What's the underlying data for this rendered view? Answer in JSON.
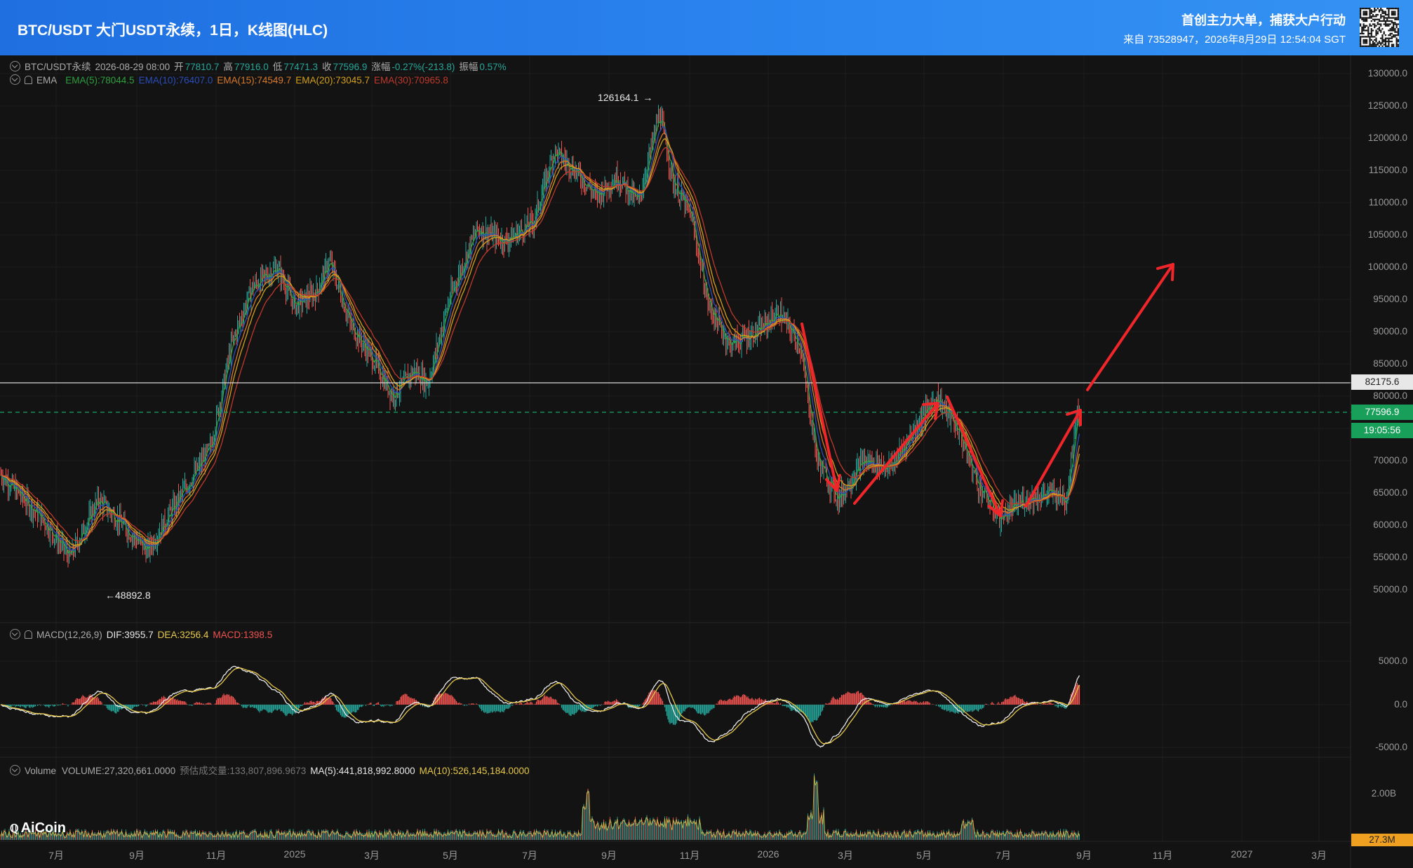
{
  "header": {
    "title": "BTC/USDT 大门USDT永续，1日，K线图(HLC)",
    "slogan": "首创主力大单，捕获大户行动",
    "source": "来自 73528947，2026年8月29日 12:54:04 SGT"
  },
  "legend_main": {
    "symbol": "BTC/USDT永续",
    "date": "2026-08-29 08:00",
    "open_label": "开",
    "open": "77810.7",
    "high_label": "高",
    "high": "77916.0",
    "low_label": "低",
    "low": "77471.3",
    "close_label": "收",
    "close": "77596.9",
    "change_label": "涨幅",
    "change": "-0.27%(-213.8)",
    "amp_label": "振幅",
    "amp": "0.57%"
  },
  "legend_ema": {
    "name": "EMA",
    "ema5": "EMA(5):78044.5",
    "ema10": "EMA(10):76407.0",
    "ema15": "EMA(15):74549.7",
    "ema20": "EMA(20):73045.7",
    "ema30": "EMA(30):70965.8"
  },
  "legend_macd": {
    "name": "MACD(12,26,9)",
    "dif": "DIF:3955.7",
    "dea": "DEA:3256.4",
    "macd": "MACD:1398.5"
  },
  "legend_volume": {
    "name": "Volume",
    "volume": "VOLUME:27,320,661.0000",
    "est": "预估成交量:133,807,896.9673",
    "ma5": "MA(5):441,818,992.8000",
    "ma10": "MA(10):526,145,184.0000"
  },
  "price_axis": [
    "130000.0",
    "125000.0",
    "120000.0",
    "115000.0",
    "110000.0",
    "105000.0",
    "100000.0",
    "95000.0",
    "90000.0",
    "85000.0",
    "80000.0",
    "70000.0",
    "65000.0",
    "60000.0",
    "55000.0",
    "50000.0"
  ],
  "macd_axis": [
    "5000.0",
    "0.0",
    "-5000.0"
  ],
  "volume_axis": [
    "2.00B"
  ],
  "price_tags": {
    "line_price": "82175.6",
    "last_price": "77596.9",
    "countdown": "19:05:56",
    "volume_tag": "27.3M"
  },
  "annotations": {
    "high": "126164.1",
    "low": "48892.8"
  },
  "x_axis": [
    "7月",
    "9月",
    "11月",
    "2025",
    "3月",
    "5月",
    "7月",
    "9月",
    "11月",
    "2026",
    "3月",
    "5月",
    "7月",
    "9月",
    "11月",
    "2027",
    "3月"
  ],
  "logo": "AiCoin",
  "colors": {
    "up": "#26a69a",
    "down": "#ef5350",
    "ema5": "#2e9f3e",
    "ema10": "#2a4dbb",
    "ema15": "#d87a2a",
    "ema20": "#d4a017",
    "ema30": "#c0392b",
    "dif": "#e8e8e8",
    "dea": "#e6c84a",
    "arrow": "#f0262a",
    "tag_green": "#18a05a",
    "tag_orange": "#f0a020"
  },
  "chart_data": {
    "type": "candlestick",
    "title": "BTC/USDT 大门USDT永续，1日，K线图(HLC)",
    "ylim": [
      45000,
      132000
    ],
    "approx_closes_monthly": [
      {
        "x": "2024-06",
        "y": 68000
      },
      {
        "x": "2024-07",
        "y": 66000
      },
      {
        "x": "2024-08",
        "y": 58000
      },
      {
        "x": "2024-09",
        "y": 63000
      },
      {
        "x": "2024-10",
        "y": 70000
      },
      {
        "x": "2024-11",
        "y": 97000
      },
      {
        "x": "2024-12",
        "y": 94000
      },
      {
        "x": "2025-01",
        "y": 102000
      },
      {
        "x": "2025-02",
        "y": 84000
      },
      {
        "x": "2025-03",
        "y": 82000
      },
      {
        "x": "2025-04",
        "y": 94000
      },
      {
        "x": "2025-05",
        "y": 104000
      },
      {
        "x": "2025-06",
        "y": 107000
      },
      {
        "x": "2025-07",
        "y": 118000
      },
      {
        "x": "2025-08",
        "y": 110000
      },
      {
        "x": "2025-09",
        "y": 114000
      },
      {
        "x": "2025-10",
        "y": 110000
      },
      {
        "x": "2025-11",
        "y": 90000
      },
      {
        "x": "2025-12",
        "y": 88000
      },
      {
        "x": "2026-01",
        "y": 92000
      },
      {
        "x": "2026-02",
        "y": 65000
      },
      {
        "x": "2026-03",
        "y": 68000
      },
      {
        "x": "2026-04",
        "y": 76000
      },
      {
        "x": "2026-05",
        "y": 80000
      },
      {
        "x": "2026-06",
        "y": 62000
      },
      {
        "x": "2026-07",
        "y": 64000
      },
      {
        "x": "2026-08",
        "y": 77597
      }
    ]
  }
}
